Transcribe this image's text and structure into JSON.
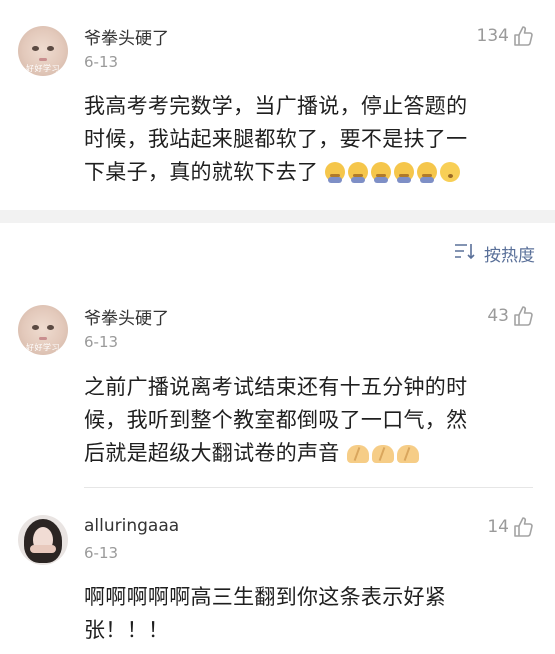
{
  "comments_top": [
    {
      "username": "爷拳头硬了",
      "date": "6-13",
      "likes": "134",
      "avatar_caption": "好好学习",
      "text_lines": [
        "我高考考完数学，当广播说，停止答题的",
        "时候，我站起来腿都软了，要不是扶了一",
        "下桌子，真的就软下去了"
      ]
    }
  ],
  "sort": {
    "label": "按热度"
  },
  "comments": [
    {
      "username": "爷拳头硬了",
      "date": "6-13",
      "likes": "43",
      "avatar_caption": "好好学习",
      "text_lines": [
        "之前广播说离考试结束还有十五分钟的时",
        "候，我听到整个教室都倒吸了一口气，然",
        "后就是超级大翻试卷的声音"
      ]
    },
    {
      "username": "alluringaaa",
      "date": "6-13",
      "likes": "14",
      "text_lines": [
        "啊啊啊啊啊高三生翻到你这条表示好紧",
        "张！！！"
      ]
    }
  ],
  "icons": {
    "like": "thumbs-up-icon",
    "sort": "sort-icon",
    "emoji_sad": "sad-face-emoji",
    "emoji_think": "thinking-face-emoji",
    "emoji_clap": "clap-emoji"
  },
  "colors": {
    "accent": "#5a7099",
    "meta": "#9a9a9a",
    "text": "#1f1f1f",
    "separator": "#f2f2f2"
  }
}
